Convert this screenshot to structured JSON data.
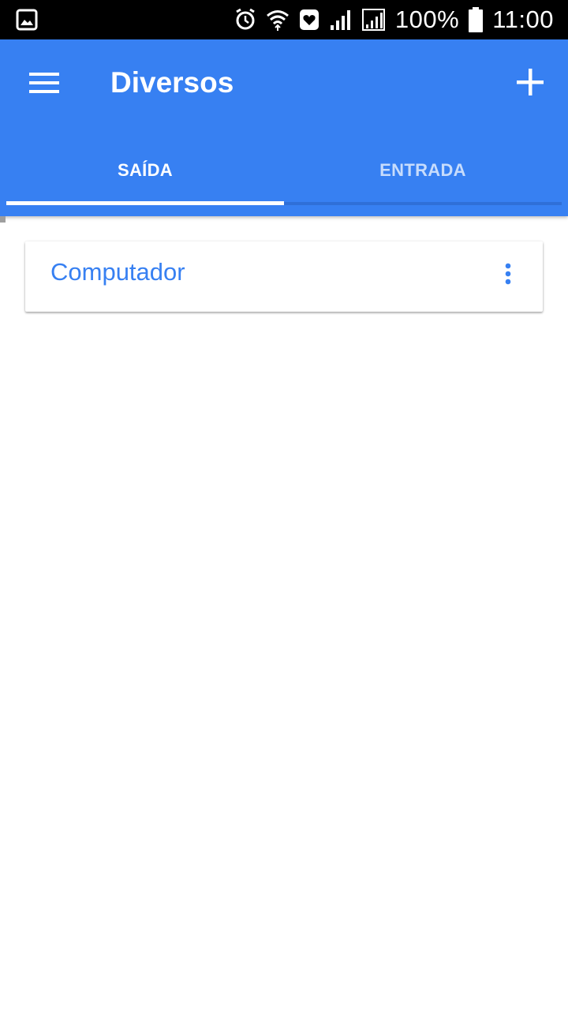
{
  "status_bar": {
    "battery_percent": "100%",
    "time": "11:00",
    "icons": [
      "gallery-icon",
      "alarm-icon",
      "wifi-icon",
      "heart-icon",
      "signal-icon",
      "signal-icon",
      "battery-icon"
    ]
  },
  "app_bar": {
    "title": "Diversos",
    "menu_icon": "hamburger-menu-icon",
    "add_icon": "plus-icon",
    "background_color": "#3780f2"
  },
  "tabs": [
    {
      "label": "SAÍDA",
      "active": true
    },
    {
      "label": "ENTRADA",
      "active": false
    }
  ],
  "cards": [
    {
      "title": "Computador",
      "menu_icon": "more-vertical-icon"
    }
  ],
  "colors": {
    "accent": "#3780f2",
    "status_bar": "#000000"
  }
}
